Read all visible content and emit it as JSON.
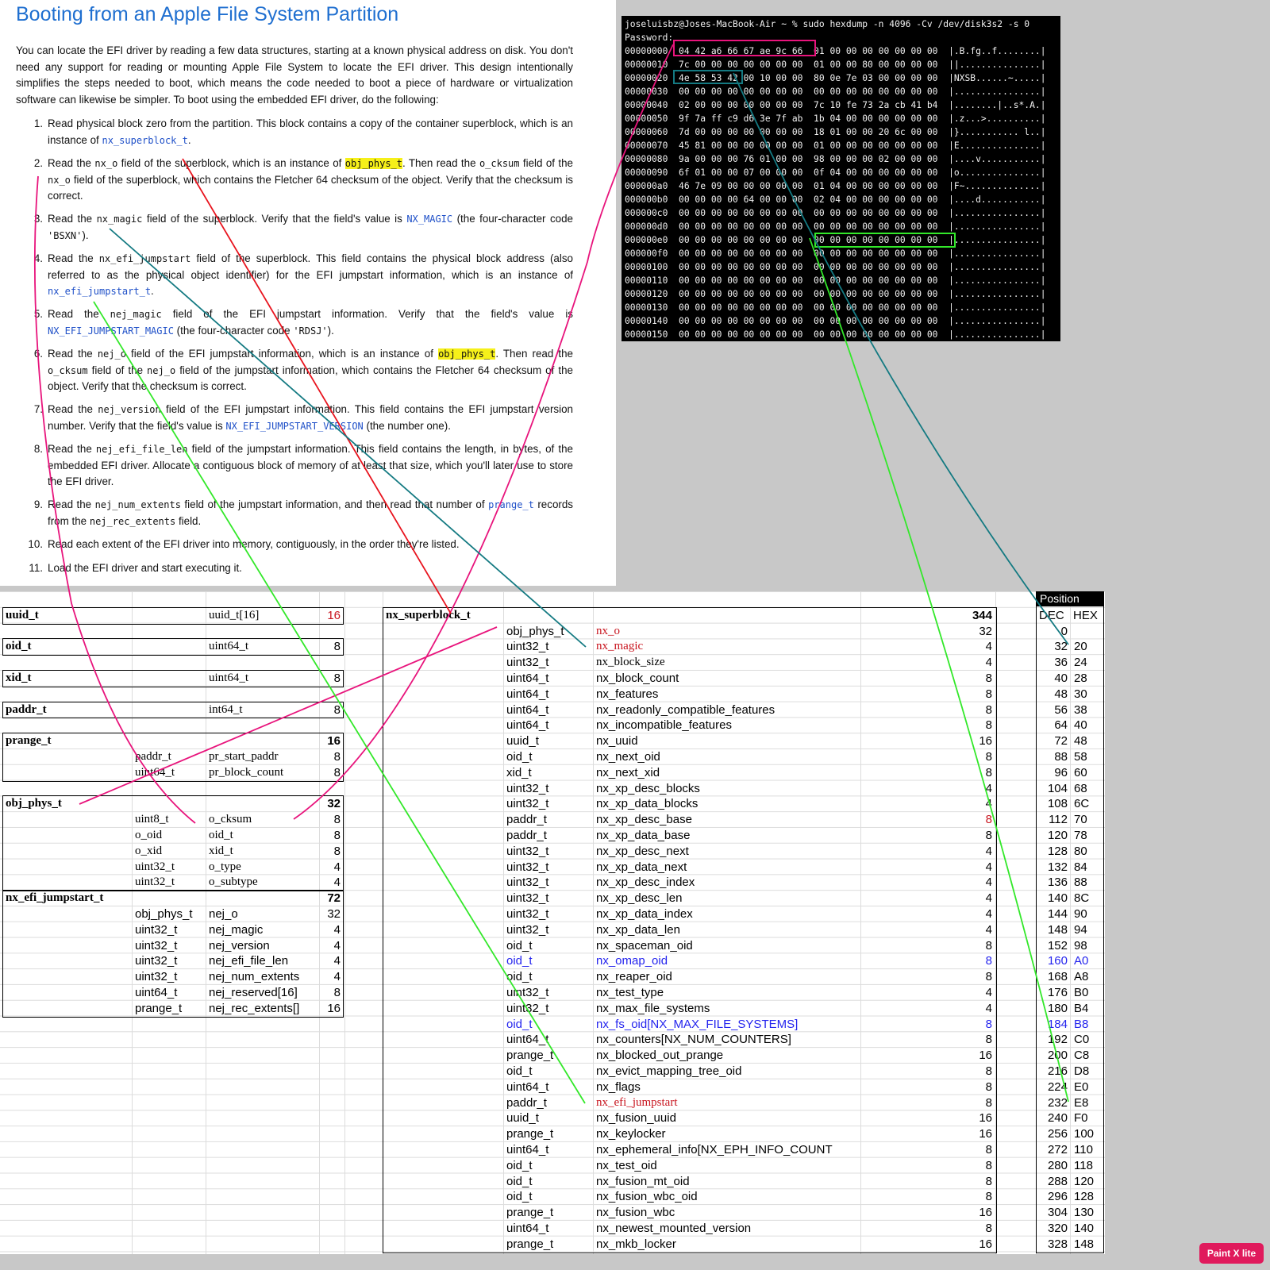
{
  "doc": {
    "title": "Booting from an Apple File System Partition",
    "intro": "You can locate the EFI driver by reading a few data structures, starting at a known physical address on disk. You don't need any support for reading or mounting Apple File System to locate the EFI driver. This design intentionally simplifies the steps needed to boot, which means the code needed to boot a piece of hardware or virtualization software can likewise be simpler. To boot using the embedded EFI driver, do the following:",
    "steps": [
      [
        {
          "t": "Read physical block zero from the partition. This block contains a copy of the container superblock, which is an instance of "
        },
        {
          "c": "nx_superblock_t",
          "k": "blue"
        },
        {
          "t": "."
        }
      ],
      [
        {
          "t": "Read the "
        },
        {
          "c": "nx_o"
        },
        {
          "t": " field of the superblock, which is an instance of "
        },
        {
          "c": "obj_phys_t",
          "k": "hl"
        },
        {
          "t": ". Then read the "
        },
        {
          "c": "o_cksum"
        },
        {
          "t": " field of the "
        },
        {
          "c": "nx_o"
        },
        {
          "t": " field of the superblock, which contains the Fletcher 64 checksum of the object. Verify that the checksum is correct."
        }
      ],
      [
        {
          "t": "Read the "
        },
        {
          "c": "nx_magic"
        },
        {
          "t": " field of the superblock. Verify that the field's value is "
        },
        {
          "c": "NX_MAGIC",
          "k": "blue"
        },
        {
          "t": " (the four-character code "
        },
        {
          "c": "'BSXN'"
        },
        {
          "t": ")."
        }
      ],
      [
        {
          "t": "Read the "
        },
        {
          "c": "nx_efi_jumpstart"
        },
        {
          "t": " field of the superblock. This field contains the physical block address (also referred to as the physical object identifier) for the EFI jumpstart information, which is an instance of "
        },
        {
          "c": "nx_efi_jumpstart_t",
          "k": "blue"
        },
        {
          "t": "."
        }
      ],
      [
        {
          "t": "Read the "
        },
        {
          "c": "nej_magic"
        },
        {
          "t": " field of the EFI jumpstart information. Verify that the field's value is "
        },
        {
          "c": "NX_EFI_JUMPSTART_MAGIC",
          "k": "blue"
        },
        {
          "t": " (the four-character code "
        },
        {
          "c": "'RDSJ'"
        },
        {
          "t": ")."
        }
      ],
      [
        {
          "t": "Read the "
        },
        {
          "c": "nej_o"
        },
        {
          "t": " field of the EFI jumpstart information, which is an instance of "
        },
        {
          "c": "obj_phys_t",
          "k": "hl"
        },
        {
          "t": ". Then read the "
        },
        {
          "c": "o_cksum"
        },
        {
          "t": " field of the "
        },
        {
          "c": "nej_o"
        },
        {
          "t": " field of the jumpstart information, which contains the Fletcher 64 checksum of the object. Verify that the checksum is correct."
        }
      ],
      [
        {
          "t": "Read the "
        },
        {
          "c": "nej_version"
        },
        {
          "t": " field of the EFI jumpstart information. This field contains the EFI jumpstart version number. Verify that the field's value is "
        },
        {
          "c": "NX_EFI_JUMPSTART_VERSION",
          "k": "blue"
        },
        {
          "t": " (the number one)."
        }
      ],
      [
        {
          "t": "Read the "
        },
        {
          "c": "nej_efi_file_len"
        },
        {
          "t": " field of the jumpstart information. This field contains the length, in bytes, of the embedded EFI driver. Allocate a contiguous block of memory of at least that size, which you'll later use to store the EFI driver."
        }
      ],
      [
        {
          "t": "Read the "
        },
        {
          "c": "nej_num_extents"
        },
        {
          "t": " field of the jumpstart information, and then read that number of "
        },
        {
          "c": "prange_t",
          "k": "blue"
        },
        {
          "t": " records from the "
        },
        {
          "c": "nej_rec_extents"
        },
        {
          "t": " field."
        }
      ],
      [
        {
          "t": "Read each extent of the EFI driver into memory, contiguously, in the order they're listed."
        }
      ],
      [
        {
          "t": "Load the EFI driver and start executing it."
        }
      ]
    ]
  },
  "terminal": {
    "prompt": "joseluisbz@Joses-MacBook-Air ~ % sudo hexdump -n 4096 -Cv /dev/disk3s2 -s 0",
    "password": "Password:",
    "rows": [
      "00000000  04 42 a6 66 67 ae 9c 66  01 00 00 00 00 00 00 00  |.B.fg..f........|",
      "00000010  7c 00 00 00 00 00 00 00  01 00 00 80 00 00 00 00  ||...............|",
      "00000020  4e 58 53 42 00 10 00 00  80 0e 7e 03 00 00 00 00  |NXSB......~.....|",
      "00000030  00 00 00 00 00 00 00 00  00 00 00 00 00 00 00 00  |................|",
      "00000040  02 00 00 00 00 00 00 00  7c 10 fe 73 2a cb 41 b4  |........|..s*.A.|",
      "00000050  9f 7a ff c9 d6 3e 7f ab  1b 04 00 00 00 00 00 00  |.z...>..........|",
      "00000060  7d 00 00 00 00 00 00 00  18 01 00 00 20 6c 00 00  |}........... l..|",
      "00000070  45 81 00 00 00 00 00 00  01 00 00 00 00 00 00 00  |E...............|",
      "00000080  9a 00 00 00 76 01 00 00  98 00 00 00 02 00 00 00  |....v...........|",
      "00000090  6f 01 00 00 07 00 00 00  0f 04 00 00 00 00 00 00  |o...............|",
      "000000a0  46 7e 09 00 00 00 00 00  01 04 00 00 00 00 00 00  |F~..............|",
      "000000b0  00 00 00 00 64 00 00 00  02 04 00 00 00 00 00 00  |....d...........|",
      "000000c0  00 00 00 00 00 00 00 00  00 00 00 00 00 00 00 00  |................|",
      "000000d0  00 00 00 00 00 00 00 00  00 00 00 00 00 00 00 00  |................|",
      "000000e0  00 00 00 00 00 00 00 00  00 00 00 00 00 00 00 00  |................|",
      "000000f0  00 00 00 00 00 00 00 00  00 00 00 00 00 00 00 00  |................|",
      "00000100  00 00 00 00 00 00 00 00  00 00 00 00 00 00 00 00  |................|",
      "00000110  00 00 00 00 00 00 00 00  00 00 00 00 00 00 00 00  |................|",
      "00000120  00 00 00 00 00 00 00 00  00 00 00 00 00 00 00 00  |................|",
      "00000130  00 00 00 00 00 00 00 00  00 00 00 00 00 00 00 00  |................|",
      "00000140  00 00 00 00 00 00 00 00  00 00 00 00 00 00 00 00  |................|",
      "00000150  00 00 00 00 00 00 00 00  00 00 00 00 00 00 00 00  |................|"
    ]
  },
  "left_tables": [
    {
      "name": "uuid_t",
      "type": "uuid_t[16]",
      "size": "16",
      "size_color": "red"
    },
    {
      "name": "oid_t",
      "type": "uint64_t",
      "size": "8"
    },
    {
      "name": "xid_t",
      "type": "uint64_t",
      "size": "8"
    },
    {
      "name": "paddr_t",
      "type": "int64_t",
      "size": "8"
    },
    {
      "name": "prange_t",
      "size": "16",
      "fields": [
        [
          "paddr_t",
          "pr_start_paddr",
          "8"
        ],
        [
          "uint64_t",
          "pr_block_count",
          "8"
        ]
      ]
    },
    {
      "name": "obj_phys_t",
      "size": "32",
      "fields": [
        [
          "uint8_t",
          "o_cksum",
          "8"
        ],
        [
          "o_oid",
          "oid_t",
          "8"
        ],
        [
          "o_xid",
          "xid_t",
          "8"
        ],
        [
          "uint32_t",
          "o_type",
          "4"
        ],
        [
          "uint32_t",
          "o_subtype",
          "4"
        ]
      ]
    },
    {
      "name": "nx_efi_jumpstart_t",
      "size": "72",
      "fields": [
        [
          "obj_phys_t",
          "nej_o",
          "32"
        ],
        [
          "uint32_t",
          "nej_magic",
          "4"
        ],
        [
          "uint32_t",
          "nej_version",
          "4"
        ],
        [
          "uint32_t",
          "nej_efi_file_len",
          "4"
        ],
        [
          "uint32_t",
          "nej_num_extents",
          "4"
        ],
        [
          "uint64_t",
          "nej_reserved[16]",
          "8"
        ],
        [
          "prange_t",
          "nej_rec_extents[]",
          "16"
        ]
      ]
    }
  ],
  "superblock": {
    "name": "nx_superblock_t",
    "size": "344",
    "position_header": "Position",
    "dec_header": "DEC",
    "hex_header": "HEX",
    "rows": [
      {
        "type": "obj_phys_t",
        "field": "nx_o",
        "size": "32",
        "dec": "0",
        "hex": "",
        "style": "red"
      },
      {
        "type": "uint32_t",
        "field": "nx_magic",
        "size": "4",
        "dec": "32",
        "hex": "20",
        "style": "red"
      },
      {
        "type": "uint32_t",
        "field": "nx_block_size",
        "size": "4",
        "dec": "36",
        "hex": "24"
      },
      {
        "type": "uint64_t",
        "field": "nx_block_count",
        "size": "8",
        "dec": "40",
        "hex": "28"
      },
      {
        "type": "uint64_t",
        "field": "nx_features",
        "size": "8",
        "dec": "48",
        "hex": "30"
      },
      {
        "type": "uint64_t",
        "field": "nx_readonly_compatible_features",
        "size": "8",
        "dec": "56",
        "hex": "38"
      },
      {
        "type": "uint64_t",
        "field": "nx_incompatible_features",
        "size": "8",
        "dec": "64",
        "hex": "40"
      },
      {
        "type": "uuid_t",
        "field": "nx_uuid",
        "size": "16",
        "dec": "72",
        "hex": "48"
      },
      {
        "type": "oid_t",
        "field": "nx_next_oid",
        "size": "8",
        "dec": "88",
        "hex": "58"
      },
      {
        "type": "xid_t",
        "field": "nx_next_xid",
        "size": "8",
        "dec": "96",
        "hex": "60"
      },
      {
        "type": "uint32_t",
        "field": "nx_xp_desc_blocks",
        "size": "4",
        "dec": "104",
        "hex": "68"
      },
      {
        "type": "uint32_t",
        "field": "nx_xp_data_blocks",
        "size": "4",
        "dec": "108",
        "hex": "6C"
      },
      {
        "type": "paddr_t",
        "field": "nx_xp_desc_base",
        "size": "8",
        "dec": "112",
        "hex": "70",
        "size_style": "red"
      },
      {
        "type": "paddr_t",
        "field": "nx_xp_data_base",
        "size": "8",
        "dec": "120",
        "hex": "78"
      },
      {
        "type": "uint32_t",
        "field": "nx_xp_desc_next",
        "size": "4",
        "dec": "128",
        "hex": "80"
      },
      {
        "type": "uint32_t",
        "field": "nx_xp_data_next",
        "size": "4",
        "dec": "132",
        "hex": "84"
      },
      {
        "type": "uint32_t",
        "field": "nx_xp_desc_index",
        "size": "4",
        "dec": "136",
        "hex": "88"
      },
      {
        "type": "uint32_t",
        "field": "nx_xp_desc_len",
        "size": "4",
        "dec": "140",
        "hex": "8C"
      },
      {
        "type": "uint32_t",
        "field": "nx_xp_data_index",
        "size": "4",
        "dec": "144",
        "hex": "90"
      },
      {
        "type": "uint32_t",
        "field": "nx_xp_data_len",
        "size": "4",
        "dec": "148",
        "hex": "94"
      },
      {
        "type": "oid_t",
        "field": "nx_spaceman_oid",
        "size": "8",
        "dec": "152",
        "hex": "98"
      },
      {
        "type": "oid_t",
        "field": "nx_omap_oid",
        "size": "8",
        "dec": "160",
        "hex": "A0",
        "style": "blue"
      },
      {
        "type": "oid_t",
        "field": "nx_reaper_oid",
        "size": "8",
        "dec": "168",
        "hex": "A8"
      },
      {
        "type": "uint32_t",
        "field": "nx_test_type",
        "size": "4",
        "dec": "176",
        "hex": "B0"
      },
      {
        "type": "uint32_t",
        "field": "nx_max_file_systems",
        "size": "4",
        "dec": "180",
        "hex": "B4"
      },
      {
        "type": "oid_t",
        "field": "nx_fs_oid[NX_MAX_FILE_SYSTEMS]",
        "size": "8",
        "dec": "184",
        "hex": "B8",
        "style": "blue"
      },
      {
        "type": "uint64_t",
        "field": "nx_counters[NX_NUM_COUNTERS]",
        "size": "8",
        "dec": "192",
        "hex": "C0"
      },
      {
        "type": "prange_t",
        "field": "nx_blocked_out_prange",
        "size": "16",
        "dec": "200",
        "hex": "C8"
      },
      {
        "type": "oid_t",
        "field": "nx_evict_mapping_tree_oid",
        "size": "8",
        "dec": "216",
        "hex": "D8"
      },
      {
        "type": "uint64_t",
        "field": "nx_flags",
        "size": "8",
        "dec": "224",
        "hex": "E0"
      },
      {
        "type": "paddr_t",
        "field": "nx_efi_jumpstart",
        "size": "8",
        "dec": "232",
        "hex": "E8",
        "style": "red"
      },
      {
        "type": "uuid_t",
        "field": "nx_fusion_uuid",
        "size": "16",
        "dec": "240",
        "hex": "F0"
      },
      {
        "type": "prange_t",
        "field": "nx_keylocker",
        "size": "16",
        "dec": "256",
        "hex": "100"
      },
      {
        "type": "uint64_t",
        "field": "nx_ephemeral_info[NX_EPH_INFO_COUNT",
        "size": "8",
        "dec": "272",
        "hex": "110"
      },
      {
        "type": "oid_t",
        "field": "nx_test_oid",
        "size": "8",
        "dec": "280",
        "hex": "118"
      },
      {
        "type": "oid_t",
        "field": "nx_fusion_mt_oid",
        "size": "8",
        "dec": "288",
        "hex": "120"
      },
      {
        "type": "oid_t",
        "field": "nx_fusion_wbc_oid",
        "size": "8",
        "dec": "296",
        "hex": "128"
      },
      {
        "type": "prange_t",
        "field": "nx_fusion_wbc",
        "size": "16",
        "dec": "304",
        "hex": "130"
      },
      {
        "type": "uint64_t",
        "field": "nx_newest_mounted_version",
        "size": "8",
        "dec": "320",
        "hex": "140"
      },
      {
        "type": "prange_t",
        "field": "nx_mkb_locker",
        "size": "16",
        "dec": "328",
        "hex": "148"
      }
    ]
  },
  "app_badge": "Paint X lite",
  "colors": {
    "magenta": "#e8147c",
    "red": "#e8141e",
    "teal": "#147a82",
    "green": "#33e82a",
    "doc_title": "#1f6fd0",
    "code_link": "#1f50c8",
    "highlight": "#f6f01a"
  }
}
